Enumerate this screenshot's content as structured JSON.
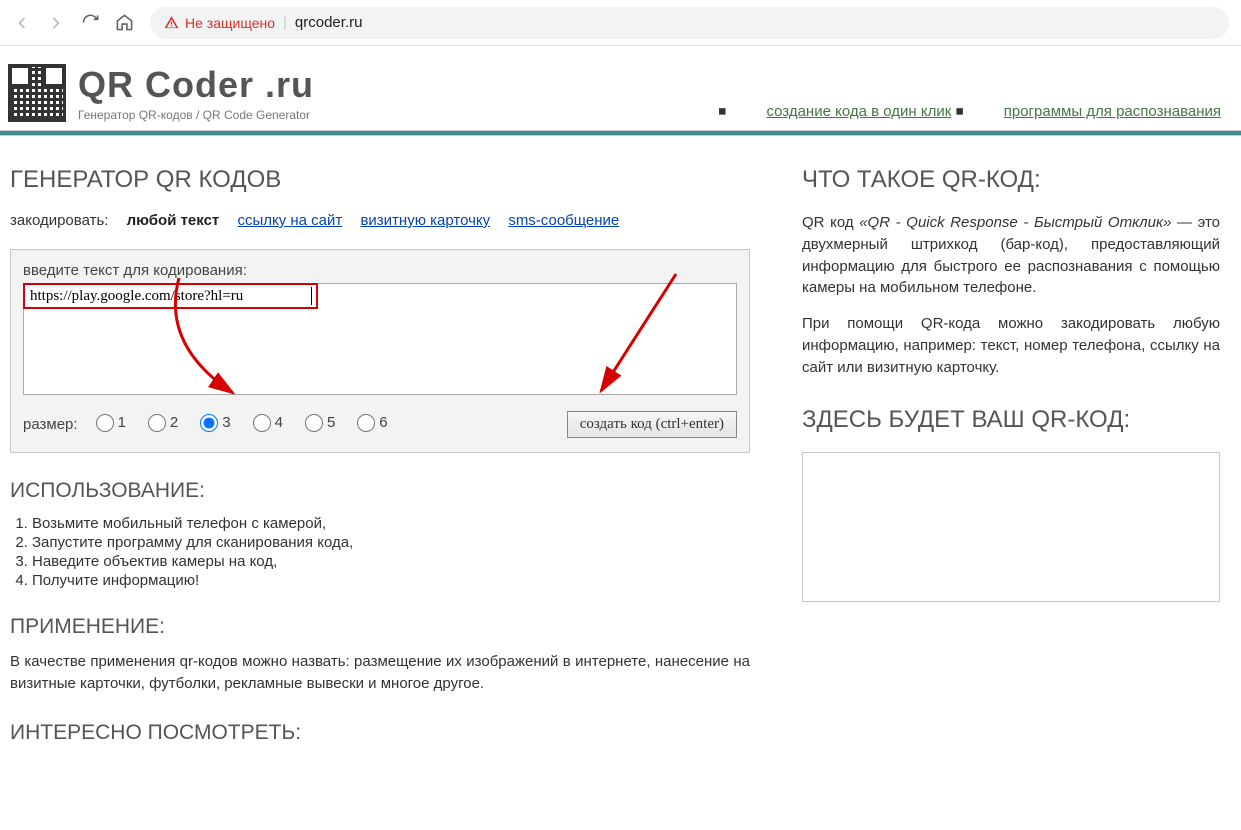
{
  "browser": {
    "not_secure": "Не защищено",
    "url_domain": "qrcoder.ru"
  },
  "site": {
    "title": "QR Coder .ru",
    "subtitle": "Генератор QR-кодов / QR Code Generator"
  },
  "header_links": {
    "one_click": "создание кода в один клик",
    "programs": "программы для распознавания"
  },
  "main": {
    "heading": "ГЕНЕРАТОР QR КОДОВ",
    "encode_label": "закодировать:",
    "tabs": {
      "any_text": "любой текст",
      "link": "ссылку на сайт",
      "vcard": "визитную карточку",
      "sms": "sms-сообщение"
    },
    "input_label": "введите текст для кодирования:",
    "input_value": "https://play.google.com/store?hl=ru",
    "size_label": "размер:",
    "sizes": [
      "1",
      "2",
      "3",
      "4",
      "5",
      "6"
    ],
    "create_button": "создать код (ctrl+enter)",
    "usage_heading": "ИСПОЛЬЗОВАНИЕ:",
    "usage_steps": [
      "Возьмите мобильный телефон с камерой,",
      "Запустите программу для сканирования кода,",
      "Наведите объектив камеры на код,",
      "Получите информацию!"
    ],
    "application_heading": "ПРИМЕНЕНИЕ:",
    "application_text": "В качестве применения qr-кодов можно назвать: размещение их изображений в интернете, нанесение на визитные карточки, футболки, рекламные вывески и многое другое.",
    "interesting_heading": "ИНТЕРЕСНО ПОСМОТРЕТЬ:"
  },
  "side": {
    "what_heading": "ЧТО ТАКОЕ QR-КОД:",
    "what_p1_a": "QR код ",
    "what_p1_em": "«QR - Quick Response - Быстрый Отклик»",
    "what_p1_b": " — это двухмерный штрихкод (бар-код), предоставляющий информацию для быстрого ее распознавания с помощью камеры на мобильном телефоне.",
    "what_p2": "При помощи QR-кода можно закодировать любую информацию, например: текст, номер телефона, ссылку на сайт или визитную карточку.",
    "result_heading": "ЗДЕСЬ БУДЕТ ВАШ QR-КОД:"
  }
}
